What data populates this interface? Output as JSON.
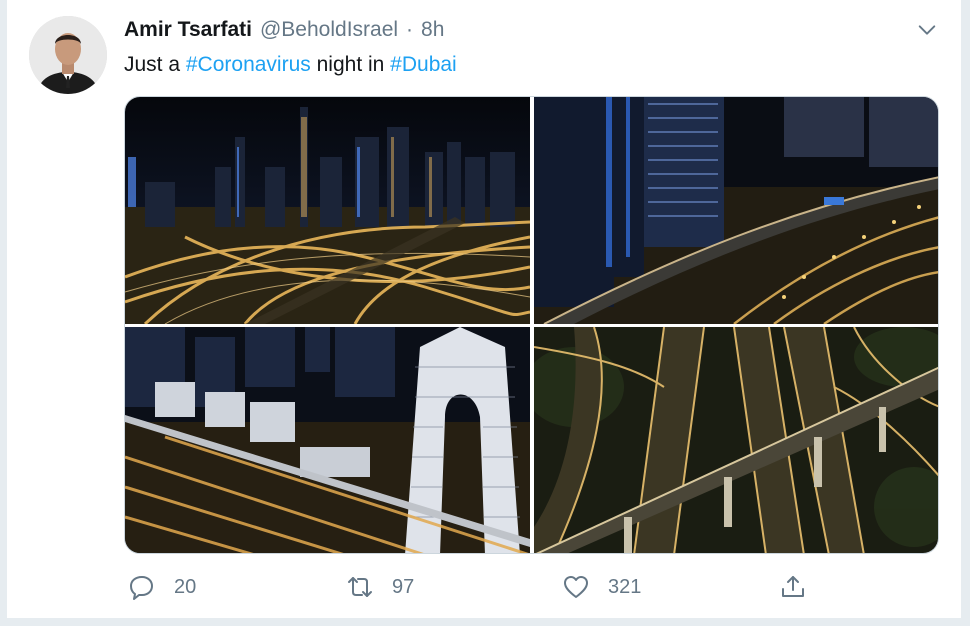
{
  "tweet": {
    "author_name": "Amir Tsarfati",
    "handle": "@BeholdIsrael",
    "separator": "·",
    "time": "8h",
    "text_prefix": "Just a ",
    "hashtag_1": "#Coronavirus",
    "text_middle": " night in ",
    "hashtag_2": "#Dubai"
  },
  "media": {
    "photos": [
      {
        "icon": "photo-dubai-skyline-interchange"
      },
      {
        "icon": "photo-dubai-metro-tower-road"
      },
      {
        "icon": "photo-dubai-frame-building-road"
      },
      {
        "icon": "photo-dubai-empty-highway-junction"
      }
    ]
  },
  "actions": {
    "reply_count": "20",
    "retweet_count": "97",
    "like_count": "321"
  },
  "colors": {
    "link": "#1da1f2",
    "secondary_text": "#657786",
    "primary_text": "#14171a",
    "background": "#e6ecf0"
  }
}
